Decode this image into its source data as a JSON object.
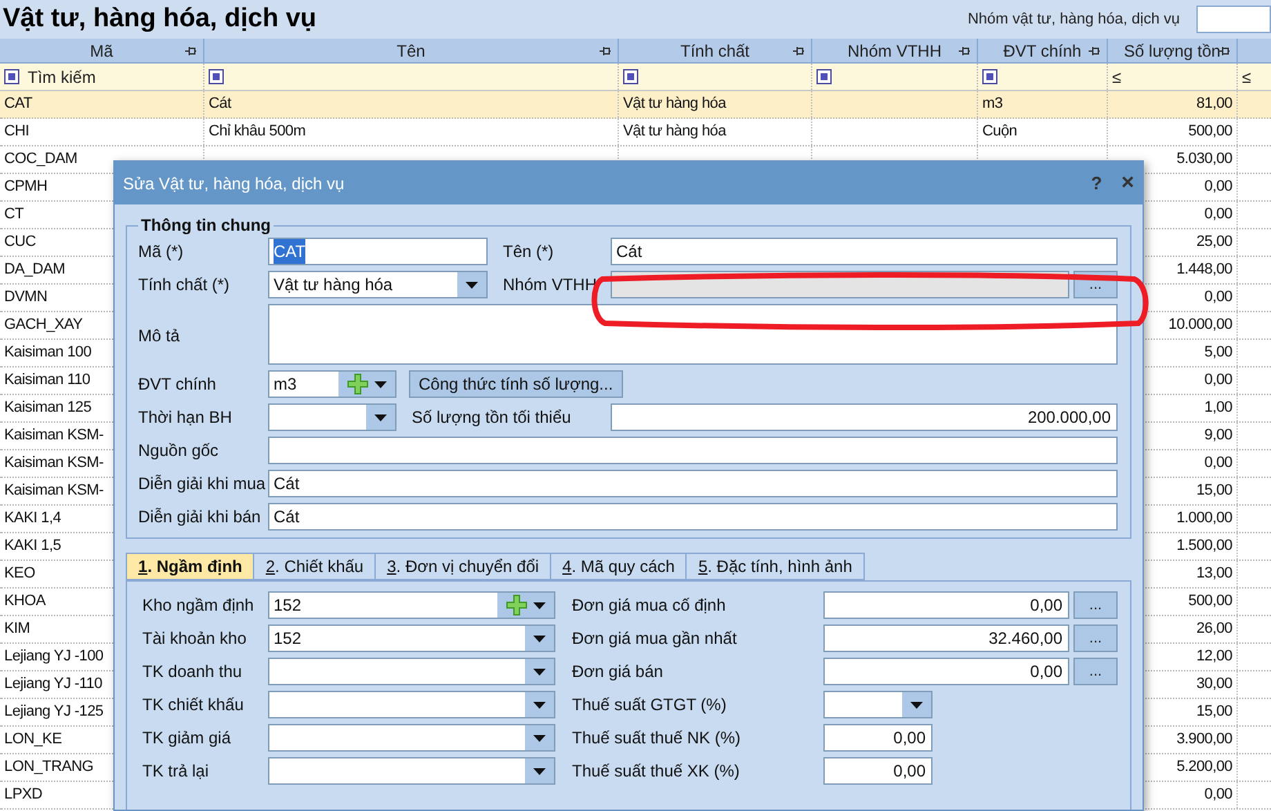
{
  "page": {
    "title": "Vật tư, hàng hóa, dịch vụ",
    "group_filter": {
      "label": "Nhóm vật tư, hàng hóa, dịch vụ"
    }
  },
  "table": {
    "columns": [
      {
        "label": "Mã"
      },
      {
        "label": "Tên"
      },
      {
        "label": "Tính chất"
      },
      {
        "label": "Nhóm VTHH"
      },
      {
        "label": "ĐVT chính"
      },
      {
        "label": "Số lượng tồn"
      }
    ],
    "filter": {
      "placeholder": "Tìm kiếm",
      "operators": [
        "≤",
        "≤"
      ]
    },
    "rows": [
      {
        "ma": "CAT",
        "ten": "Cát",
        "tinh_chat": "Vật tư hàng hóa",
        "dvt": "m3",
        "so_luong": "81,00",
        "selected": true
      },
      {
        "ma": "CHI",
        "ten": "Chỉ khâu 500m",
        "tinh_chat": "Vật tư hàng hóa",
        "dvt": "Cuộn",
        "so_luong": "500,00",
        "selected": false
      },
      {
        "ma": "COC_DAM",
        "so_luong": "5.030,00",
        "selected": false
      },
      {
        "ma": "CPMH",
        "so_luong": "0,00",
        "selected": false
      },
      {
        "ma": "CT",
        "so_luong": "0,00",
        "selected": false
      },
      {
        "ma": "CUC",
        "so_luong": "25,00",
        "selected": false
      },
      {
        "ma": "DA_DAM",
        "so_luong": "1.448,00",
        "selected": false
      },
      {
        "ma": "DVMN",
        "so_luong": "0,00",
        "selected": false
      },
      {
        "ma": "GACH_XAY",
        "so_luong": "10.000,00",
        "selected": false
      },
      {
        "ma": "Kaisiman 100",
        "so_luong": "5,00",
        "selected": false
      },
      {
        "ma": "Kaisiman 110",
        "so_luong": "0,00",
        "selected": false
      },
      {
        "ma": "Kaisiman 125",
        "so_luong": "1,00",
        "selected": false
      },
      {
        "ma": "Kaisiman KSM-",
        "so_luong": "9,00",
        "selected": false
      },
      {
        "ma": "Kaisiman KSM-",
        "so_luong": "0,00",
        "selected": false
      },
      {
        "ma": "Kaisiman KSM-",
        "so_luong": "15,00",
        "selected": false
      },
      {
        "ma": "KAKI 1,4",
        "so_luong": "1.000,00",
        "selected": false
      },
      {
        "ma": "KAKI 1,5",
        "so_luong": "1.500,00",
        "selected": false
      },
      {
        "ma": "KEO",
        "so_luong": "13,00",
        "selected": false
      },
      {
        "ma": "KHOA",
        "so_luong": "500,00",
        "selected": false
      },
      {
        "ma": "KIM",
        "so_luong": "26,00",
        "selected": false
      },
      {
        "ma": "Lejiang YJ -100",
        "so_luong": "12,00",
        "selected": false
      },
      {
        "ma": "Lejiang YJ -110",
        "so_luong": "30,00",
        "selected": false
      },
      {
        "ma": "Lejiang YJ -125",
        "so_luong": "15,00",
        "selected": false
      },
      {
        "ma": "LON_KE",
        "so_luong": "3.900,00",
        "selected": false
      },
      {
        "ma": "LON_TRANG",
        "so_luong": "5.200,00",
        "selected": false
      },
      {
        "ma": "LPXD",
        "so_luong": "0,00",
        "selected": false
      }
    ]
  },
  "dialog": {
    "title": "Sửa Vật tư, hàng hóa, dịch vụ",
    "help": "?",
    "close": "×",
    "group": {
      "title": "Thông tin chung",
      "ma": {
        "label": "Mã (*)",
        "value": "CAT",
        "value_selected": true
      },
      "ten": {
        "label": "Tên (*)",
        "value": "Cát"
      },
      "tinh_chat": {
        "label": "Tính chất (*)",
        "value": "Vật tư hàng hóa"
      },
      "nhom": {
        "label": "Nhóm VTHH",
        "disabled": true,
        "button": "..."
      },
      "mo_ta": {
        "label": "Mô tả"
      },
      "dvt": {
        "label": "ĐVT chính",
        "value": "m3",
        "button": "Công thức tính số lượng..."
      },
      "bh": {
        "label": "Thời hạn BH"
      },
      "ton_min": {
        "label": "Số lượng tồn tối thiểu",
        "value": "200.000,00"
      },
      "nguon_goc": {
        "label": "Nguồn gốc"
      },
      "mua": {
        "label": "Diễn giải khi mua",
        "value": "Cát"
      },
      "ban": {
        "label": "Diễn giải khi bán",
        "value": "Cát"
      }
    },
    "tabs": [
      {
        "label": "1. Ngầm định",
        "selected": true
      },
      {
        "label": "2. Chiết khấu",
        "selected": false
      },
      {
        "label": "3. Đơn vị chuyển đổi",
        "selected": false
      },
      {
        "label": "4. Mã quy cách",
        "selected": false
      },
      {
        "label": "5. Đặc tính, hình ảnh",
        "selected": false
      }
    ],
    "left_fields": [
      {
        "label": "Kho ngầm định",
        "value": "152",
        "kind": "combo_add"
      },
      {
        "label": "Tài khoản kho",
        "value": "152",
        "kind": "combo"
      },
      {
        "label": "TK doanh thu",
        "kind": "combo"
      },
      {
        "label": "TK chiết khấu",
        "kind": "combo"
      },
      {
        "label": "TK giảm giá",
        "kind": "combo"
      },
      {
        "label": "TK trả lại",
        "kind": "combo"
      }
    ],
    "right_fields": [
      {
        "label": "Đơn giá mua cố định",
        "value": "0,00",
        "kind": "price",
        "button": "..."
      },
      {
        "label": "Đơn giá mua gần nhất",
        "value": "32.460,00",
        "kind": "price",
        "button": "..."
      },
      {
        "label": "Đơn giá bán",
        "value": "0,00",
        "kind": "price",
        "button": "..."
      },
      {
        "label": "Thuế suất GTGT (%)",
        "kind": "combo"
      },
      {
        "label": "Thuế suất thuế NK (%)",
        "value": "0,00",
        "kind": "number"
      },
      {
        "label": "Thuế suất thuế XK (%)",
        "value": "0,00",
        "kind": "number"
      }
    ]
  }
}
